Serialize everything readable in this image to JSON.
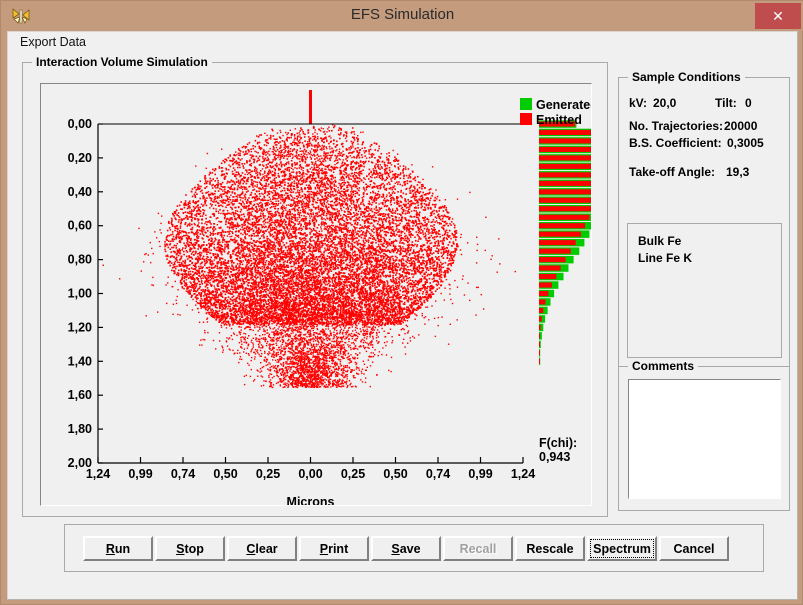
{
  "window": {
    "title": "EFS Simulation",
    "icon": "butterfly-icon",
    "close_label": "✕",
    "titlebar_color": "#c49b7d",
    "close_color": "#bf4d4d"
  },
  "menu": {
    "items": [
      {
        "label": "Export Data"
      }
    ]
  },
  "simulation_group": {
    "label": "Interaction Volume Simulation"
  },
  "sample_conditions": {
    "label": "Sample Conditions",
    "kv_label": "kV:",
    "kv_value": "20,0",
    "tilt_label": "Tilt:",
    "tilt_value": "0",
    "trajectories_label": "No. Trajectories:",
    "trajectories_value": "20000",
    "bs_label": "B.S. Coefficient:",
    "bs_value": "0,3005",
    "takeoff_label": "Take-off Angle:",
    "takeoff_value": "19,3",
    "list_items": [
      {
        "label": "Bulk Fe"
      },
      {
        "label": "Line Fe K"
      }
    ]
  },
  "comments": {
    "label": "Comments",
    "value": "",
    "placeholder": ""
  },
  "buttons": [
    {
      "name": "run",
      "label": "Run",
      "accel": "R",
      "disabled": false,
      "focused": false
    },
    {
      "name": "stop",
      "label": "Stop",
      "accel": "S",
      "disabled": false,
      "focused": false
    },
    {
      "name": "clear",
      "label": "Clear",
      "accel": "C",
      "disabled": false,
      "focused": false
    },
    {
      "name": "print",
      "label": "Print",
      "accel": "P",
      "disabled": false,
      "focused": false
    },
    {
      "name": "save",
      "label": "Save",
      "accel": "S",
      "disabled": false,
      "focused": false
    },
    {
      "name": "recall",
      "label": "Recall",
      "accel": "",
      "disabled": true,
      "focused": false
    },
    {
      "name": "rescale",
      "label": "Rescale",
      "accel": "",
      "disabled": false,
      "focused": false
    },
    {
      "name": "spectrum",
      "label": "Spectrum",
      "accel": "",
      "disabled": false,
      "focused": true
    },
    {
      "name": "cancel",
      "label": "Cancel",
      "accel": "",
      "disabled": false,
      "focused": false
    }
  ],
  "chart_data": {
    "type": "scatter",
    "title": "",
    "xlabel": "Microns",
    "ylabel": "",
    "xticks": [
      "1,24",
      "0,99",
      "0,74",
      "0,50",
      "0,25",
      "0,00",
      "0,25",
      "0,50",
      "0,74",
      "0,99",
      "1,24"
    ],
    "yticks": [
      "0,00",
      "0,20",
      "0,40",
      "0,60",
      "0,80",
      "1,00",
      "1,20",
      "1,40",
      "1,60",
      "1,80",
      "2,00"
    ],
    "xlim": [
      -1.24,
      1.24
    ],
    "ylim": [
      2.0,
      0.0
    ],
    "grid": false,
    "point_color": "#ff0000",
    "n_points": 20000,
    "beam_line": {
      "x": 0.0,
      "color": "#ff0000",
      "from_top": true
    },
    "annotation": {
      "label": "F(chi):",
      "value": "0,943"
    },
    "legend": {
      "position": "top-right",
      "entries": [
        {
          "name": "Generated",
          "color": "#00cc00"
        },
        {
          "name": "Emitted",
          "color": "#ff0000"
        }
      ]
    },
    "depth_histogram": {
      "type": "bar",
      "orientation": "horizontal",
      "generated_color": "#00cc00",
      "emitted_color": "#ff0000",
      "depths": [
        0.0,
        0.05,
        0.1,
        0.15,
        0.2,
        0.25,
        0.3,
        0.35,
        0.4,
        0.45,
        0.5,
        0.55,
        0.6,
        0.65,
        0.7,
        0.75,
        0.8,
        0.85,
        0.9,
        0.95,
        1.0,
        1.05,
        1.1,
        1.15,
        1.2,
        1.25,
        1.3,
        1.35,
        1.4
      ],
      "generated": [
        0.52,
        0.78,
        0.9,
        0.97,
        1.0,
        1.0,
        0.98,
        0.96,
        0.93,
        0.9,
        0.86,
        0.81,
        0.76,
        0.7,
        0.63,
        0.56,
        0.48,
        0.41,
        0.34,
        0.27,
        0.21,
        0.16,
        0.12,
        0.085,
        0.06,
        0.04,
        0.025,
        0.014,
        0.006
      ],
      "emitted": [
        0.5,
        0.74,
        0.85,
        0.91,
        0.93,
        0.92,
        0.9,
        0.87,
        0.84,
        0.8,
        0.75,
        0.7,
        0.64,
        0.58,
        0.51,
        0.44,
        0.37,
        0.3,
        0.24,
        0.18,
        0.13,
        0.09,
        0.06,
        0.037,
        0.022,
        0.011,
        0.005,
        0.002,
        0.0
      ]
    }
  }
}
